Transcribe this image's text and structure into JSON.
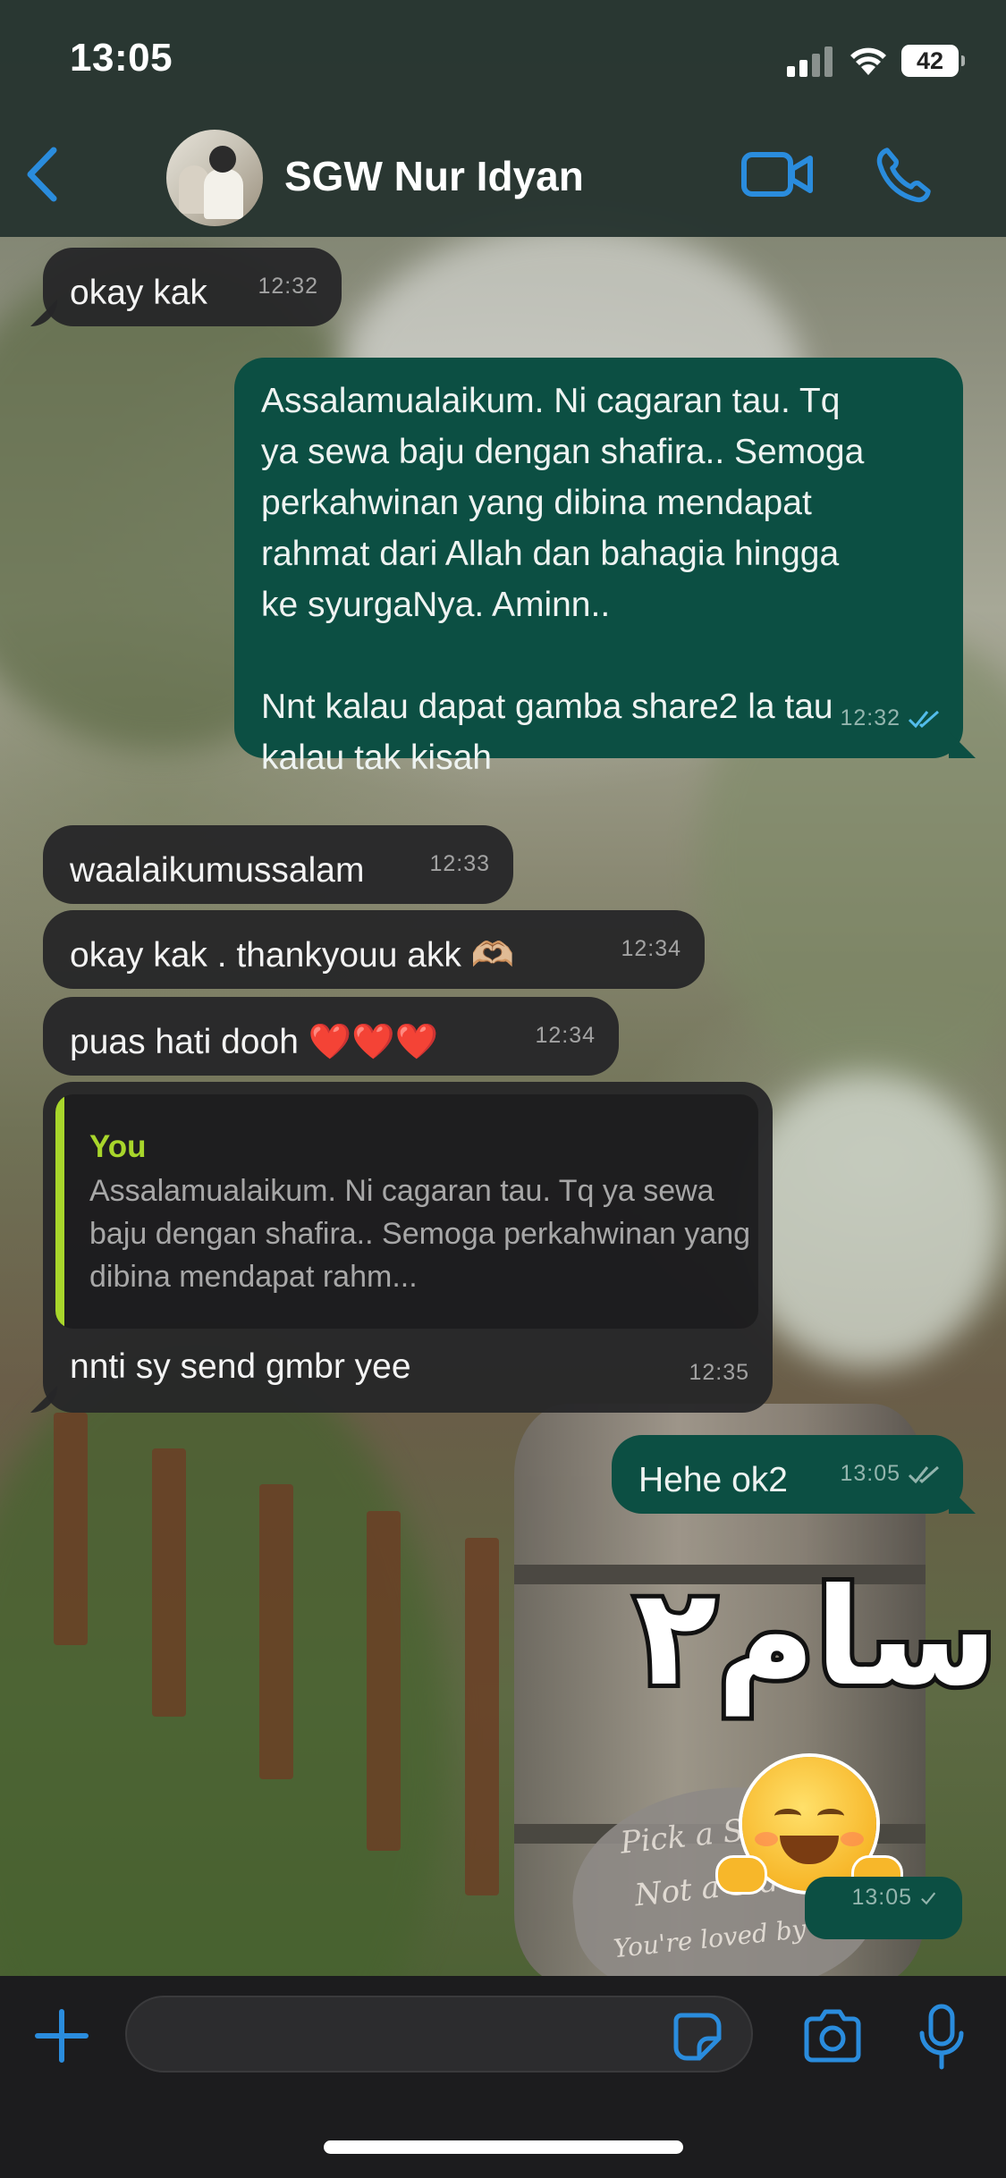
{
  "status_bar": {
    "time": "13:05",
    "battery": "42"
  },
  "header": {
    "contact_name": "SGW Nur Idyan"
  },
  "messages": [
    {
      "direction": "in",
      "text": "okay kak",
      "time": "12:32"
    },
    {
      "direction": "out",
      "text": "Assalamualaikum. Ni cagaran tau. Tq\nya sewa baju dengan shafira.. Semoga\nperkahwinan yang dibina mendapat\nrahmat dari Allah dan bahagia hingga\nke syurgaNya. Aminn..\n\nNnt kalau dapat gamba share2 la tau\nkalau tak kisah",
      "time": "12:32",
      "status": "read"
    },
    {
      "direction": "in",
      "text": "waalaikumussalam",
      "time": "12:33"
    },
    {
      "direction": "in",
      "text": "okay kak . thankyouu akk 🫶🏼",
      "time": "12:34"
    },
    {
      "direction": "in",
      "text": "puas hati dooh ❤️❤️❤️",
      "time": "12:34"
    },
    {
      "direction": "in",
      "text": "nnti sy send gmbr yee",
      "time": "12:35",
      "quote": {
        "author": "You",
        "text": "Assalamualaikum. Ni cagaran tau. Tq ya sewa baju dengan shafira.. Semoga perkahwinan yang dibina mendapat rahm..."
      }
    },
    {
      "direction": "out",
      "text": "Hehe ok2",
      "time": "13:05",
      "status": "delivered"
    },
    {
      "direction": "out",
      "type": "sticker",
      "sticker_text": "سام٢",
      "sticker_emoji": "smiling-face-with-open-hands",
      "time": "13:05",
      "status": "sent"
    }
  ],
  "colors": {
    "header_bg": "#263430",
    "incoming_bubble": "#262628",
    "outgoing_bubble": "#0c4f43",
    "accent_blue": "#2a8cdd",
    "quote_accent": "#a8d62b",
    "read_ticks": "#53bdeb"
  },
  "icons": {
    "back": "chevron-left-icon",
    "video": "video-camera-icon",
    "call": "phone-icon",
    "attach": "plus-icon",
    "sticker": "sticker-icon",
    "camera": "camera-icon",
    "mic": "microphone-icon"
  }
}
